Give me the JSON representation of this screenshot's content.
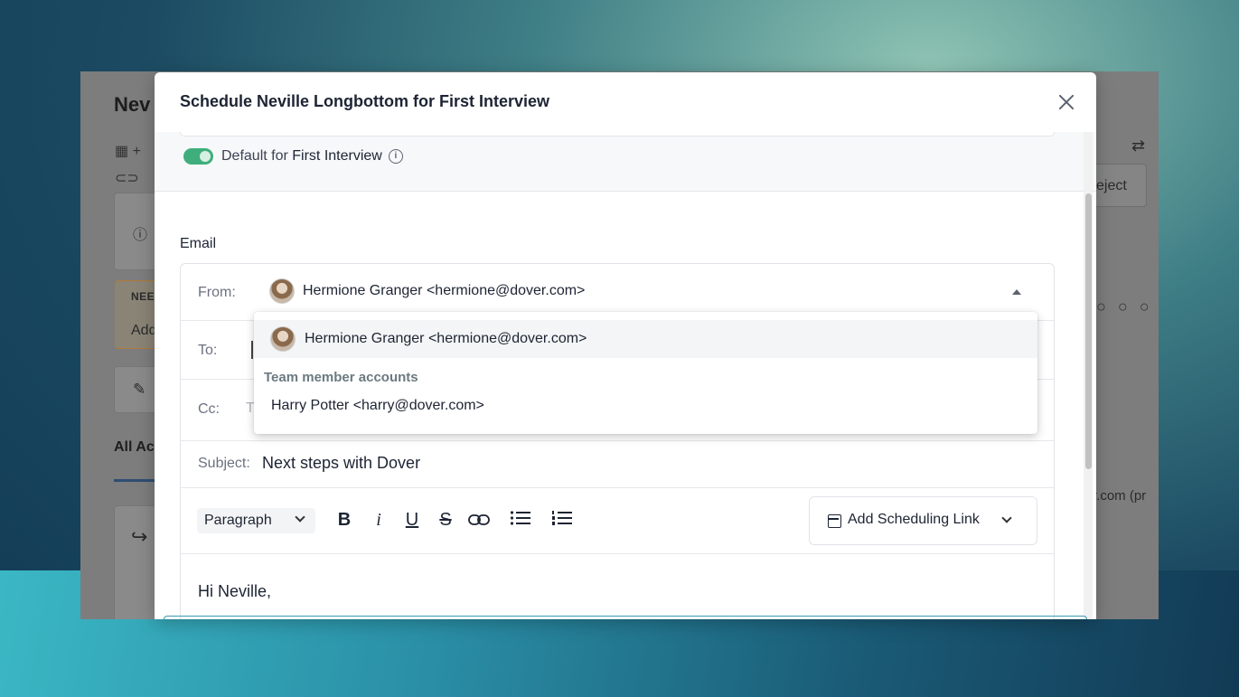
{
  "background_page": {
    "title_fragment": "Nev",
    "need_badge": "NEE",
    "need_action": "Add",
    "tab_fragment": "All Ac",
    "right_button_fragment": "eject",
    "stage_circles": "○ ○ ○",
    "email_fragment": "r.com (pr"
  },
  "modal": {
    "title": "Schedule Neville Longbottom for First Interview",
    "default_toggle": {
      "prefix": "Default for ",
      "stage": "First Interview",
      "enabled": true
    },
    "section_label": "Email",
    "from": {
      "label": "From:",
      "value": "Hermione Granger <hermione@dover.com>"
    },
    "to": {
      "label": "To:"
    },
    "cc": {
      "label": "Cc:",
      "placeholder": "T"
    },
    "subject": {
      "label": "Subject:",
      "value": "Next steps with Dover"
    },
    "toolbar": {
      "paragraph_select": "Paragraph",
      "bold": "B",
      "italic": "i",
      "underline": "U",
      "strikethrough": "S",
      "link_icon": "link-icon",
      "bullet_list_icon": "bullet-list-icon",
      "numbered_list_icon": "numbered-list-icon",
      "scheduling_button": "Add Scheduling Link"
    },
    "body_greeting": "Hi Neville,"
  },
  "from_dropdown": {
    "selected_option": "Hermione Granger <hermione@dover.com>",
    "group_label": "Team member accounts",
    "options": [
      "Harry Potter <harry@dover.com>"
    ]
  },
  "colors": {
    "toggle_on": "#3fae7c",
    "text_primary": "#1d2433",
    "group_label": "#6b7a80"
  }
}
